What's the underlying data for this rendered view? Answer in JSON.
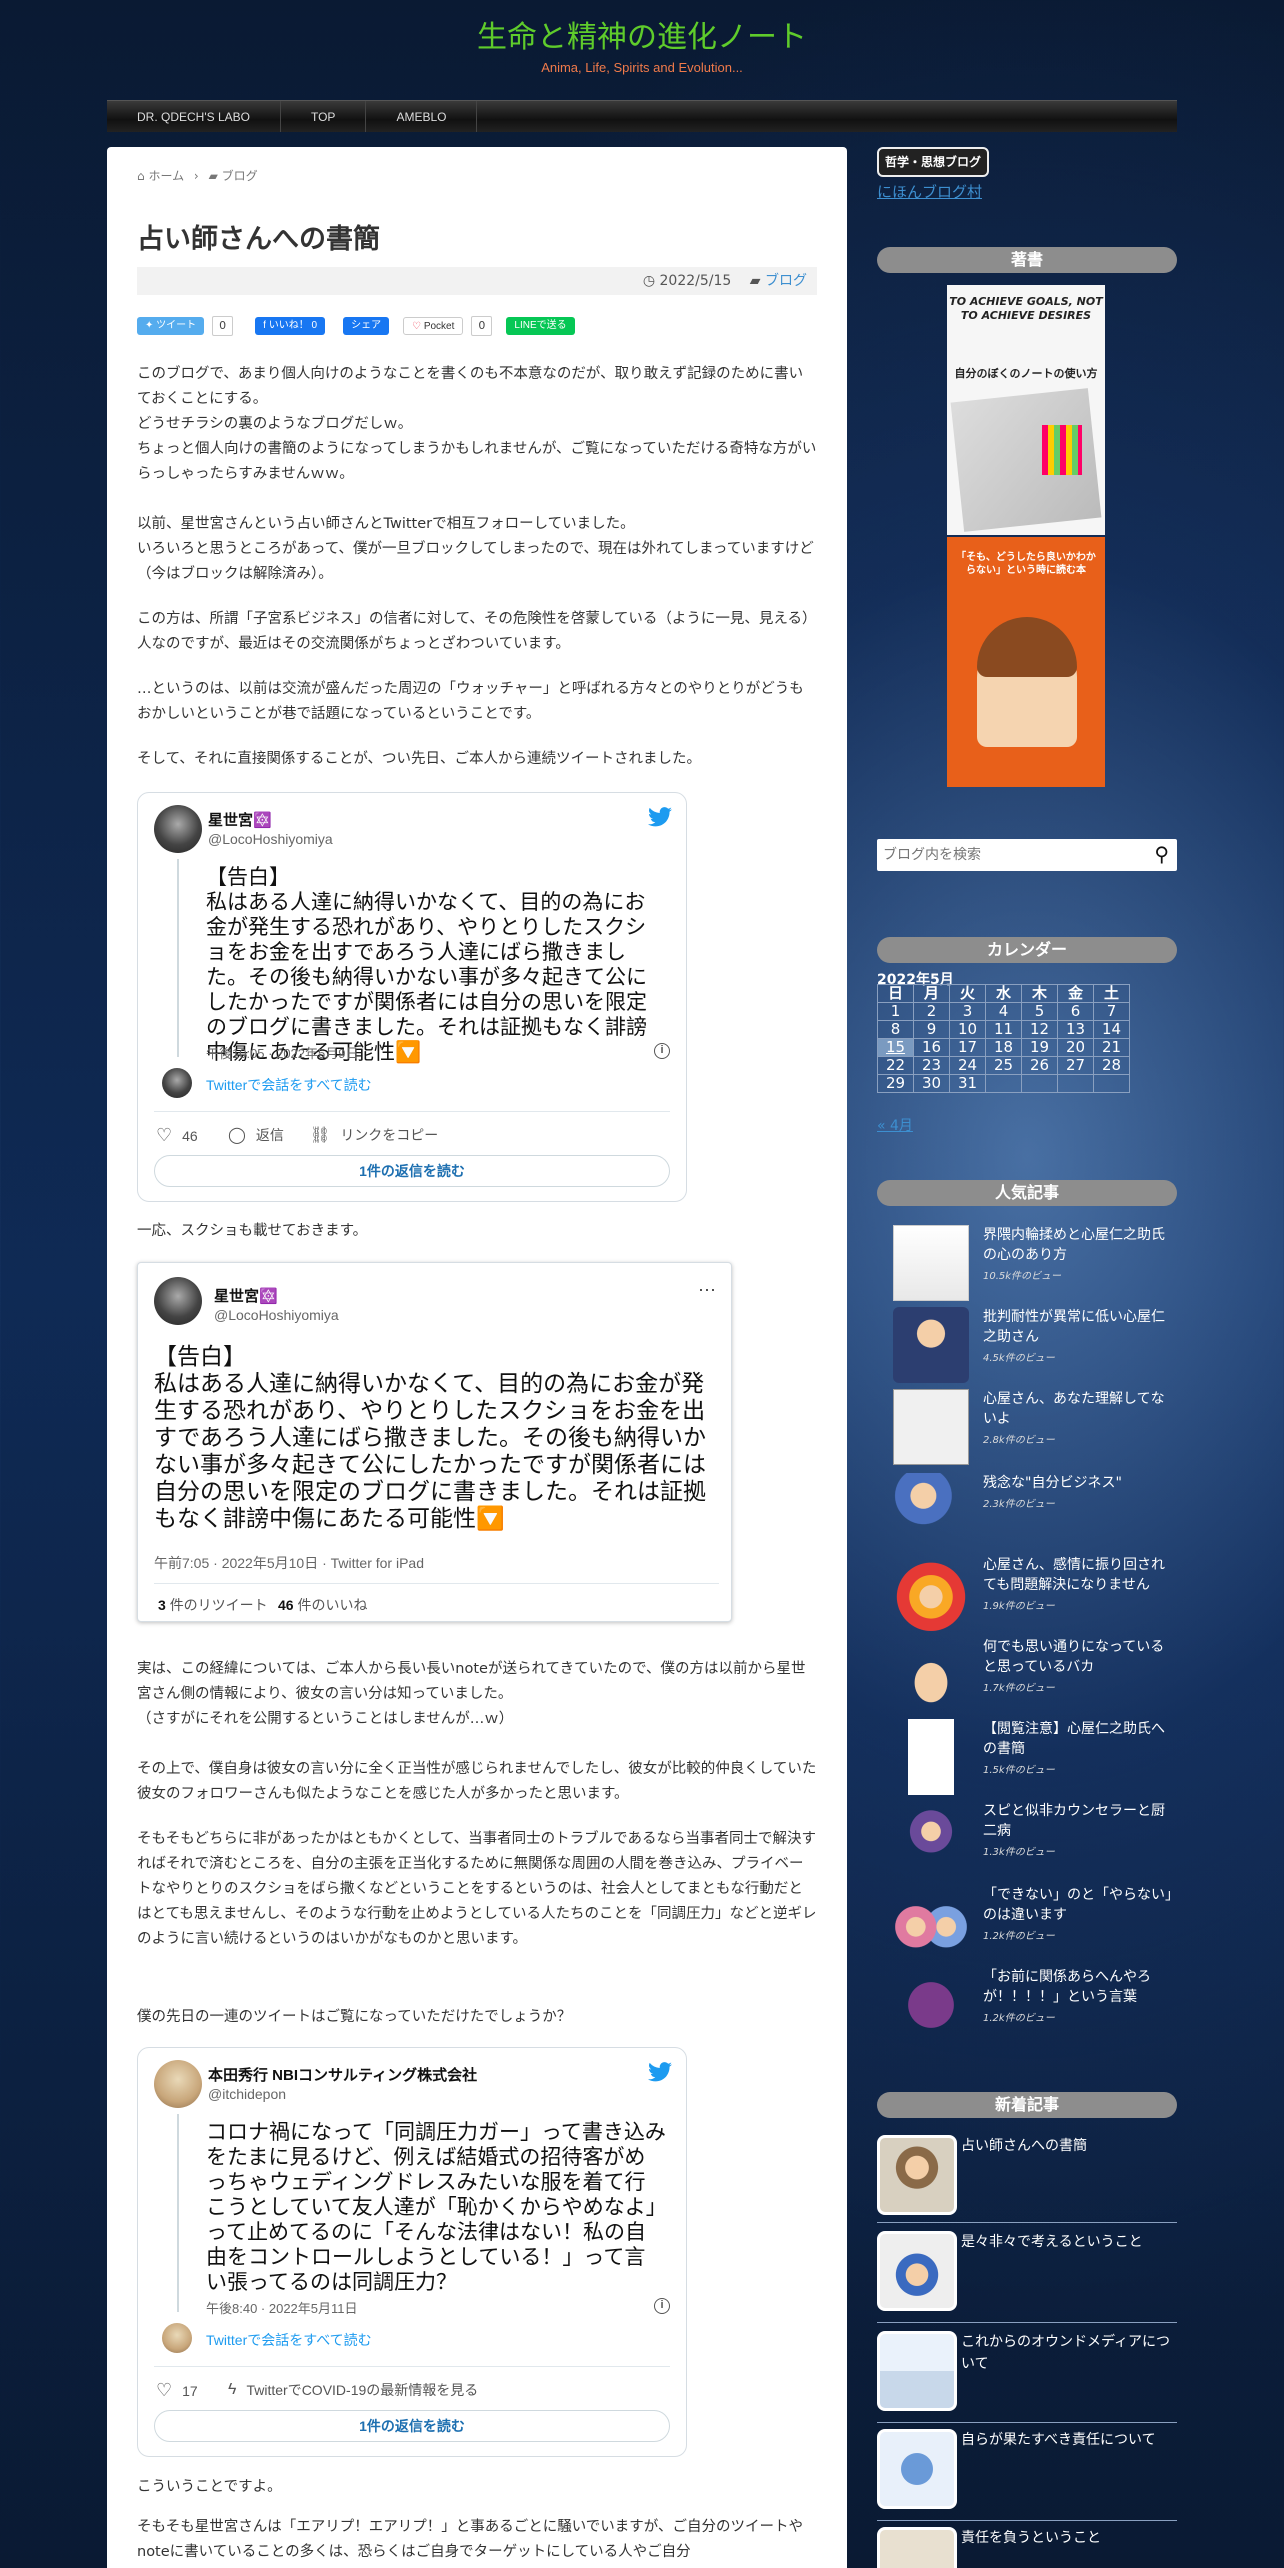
{
  "header": {
    "title": "生命と精神の進化ノート",
    "tagline": "Anima, Life, Spirits and Evolution..."
  },
  "nav": [
    "DR. QDECH'S LABO",
    "TOP",
    "AMEBLO"
  ],
  "breadcrumb": {
    "home": "ホーム",
    "separator": "›",
    "category": "ブログ"
  },
  "post": {
    "title": "占い師さんへの書簡",
    "date": "2022/5/15",
    "category": "ブログ",
    "share": {
      "tweet": "ツイート",
      "tweet_count": "0",
      "like": "いいね！",
      "like_count": "0",
      "share": "シェア",
      "pocket": "Pocket",
      "pocket_count": "0",
      "line": "LINEで送る"
    },
    "p1": "このブログで、あまり個人向けのようなことを書くのも不本意なのだが、取り敢えず記録のために書いておくことにする。\nどうせチラシの裏のようなブログだしｗ。\nちょっと個人向けの書簡のようになってしまうかもしれませんが、ご覧になっていただける奇特な方がいらっしゃったらすみませんｗｗ。",
    "p2": "以前、星世宮さんという占い師さんとTwitterで相互フォローしていました。\nいろいろと思うところがあって、僕が一旦ブロックしてしまったので、現在は外れてしまっていますけど（今はブロックは解除済み）。",
    "p3": "この方は、所謂「子宮系ビジネス」の信者に対して、その危険性を啓蒙している（ように一見、見える）人なのですが、最近はその交流関係がちょっとざわついています。",
    "p4": "…というのは、以前は交流が盛んだった周辺の「ウォッチャー」と呼ばれる方々とのやりとりがどうもおかしいということが巷で話題になっているということです。",
    "p5": "そして、それに直接関係することが、つい先日、ご本人から連続ツイートされました。",
    "p6": "一応、スクショも載せておきます。",
    "p7": "実は、この経緯については、ご本人から長い長いnoteが送られてきていたので、僕の方は以前から星世宮さん側の情報により、彼女の言い分は知っていました。\n（さすがにそれを公開するということはしませんが…ｗ）",
    "p8": "その上で、僕自身は彼女の言い分に全く正当性が感じられませんでしたし、彼女が比較的仲良くしていた彼女のフォロワーさんも似たようなことを感じた人が多かったと思います。",
    "p9": "そもそもどちらに非があったかはともかくとして、当事者同士のトラブルであるなら当事者同士で解決すればそれで済むところを、自分の主張を正当化するために無関係な周囲の人間を巻き込み、プライベートなやりとりのスクショをばら撒くなどということをするというのは、社会人としてまともな行動だとはとても思えませんし、そのような行動を止めようとしている人たちのことを「同調圧力」などと逆ギレのように言い続けるというのはいかがなものかと思います。",
    "p10": "僕の先日の一連のツイートはご覧になっていただけたでしょうか？",
    "p11": "こういうことですよ。",
    "p12": "そもそも星世宮さんは「エアリプ！エアリプ！」と事あるごとに騒いでいますが、ご自分のツイートやnoteに書いていることの多くは、恐らくはご自身でターゲットにしている人やご自分"
  },
  "tweet1": {
    "name": "星世宮🔯",
    "handle": "@LocoHoshiyomiya",
    "body": "【告白】\n私はある人達に納得いかなくて、目的の為にお金が発生する恐れがあり、やりとりしたスクショをお金を出すであろう人達にばら撒きました。その後も納得いかない事が多々起きて公にしたかったですが関係者には自分の思いを限定のブログに書きました。それは証拠もなく誹謗中傷にあたる可能性🔽",
    "date": "午後10:05 · 2022年5月9日",
    "thread_link": "Twitterで会話をすべて読む",
    "likes": "46",
    "reply": "返信",
    "copy_link": "リンクをコピー",
    "read_replies": "1件の返信を読む"
  },
  "tweet2": {
    "name": "星世宮🔯",
    "handle": "@LocoHoshiyomiya",
    "body": "【告白】\n私はある人達に納得いかなくて、目的の為にお金が発生する恐れがあり、やりとりしたスクショをお金を出すであろう人達にばら撒きました。その後も納得いかない事が多々起きて公にしたかったですが関係者には自分の思いを限定のブログに書きました。それは証拠もなく誹謗中傷にあたる可能性🔽",
    "date": "午前7:05 · 2022年5月10日 · Twitter for iPad",
    "retweets": "3",
    "retweets_label": "件のリツイート",
    "likes": "46",
    "likes_label": "件のいいね"
  },
  "tweet3": {
    "name": "本田秀行 NBIコンサルティング株式会社",
    "handle": "@itchidepon",
    "body": "コロナ禍になって「同調圧力ガー」って書き込みをたまに見るけど、例えば結婚式の招待客がめっちゃウェディングドレスみたいな服を着て行こうとしていて友人達が「恥かくからやめなよ」って止めてるのに「そんな法律はない！私の自由をコントロールしようとしている！」って言い張ってるのは同調圧力？",
    "date": "午後8:40 · 2022年5月11日",
    "thread_link": "Twitterで会話をすべて読む",
    "likes": "17",
    "covid": "TwitterでCOVID-19の最新情報を見る",
    "read_replies": "1件の返信を読む"
  },
  "sidebar": {
    "ranking_badge": "哲学・思想ブログ",
    "ranking_link": "にほんブログ村",
    "books_head": "著書",
    "book1_title": "TO ACHIEVE GOALS, NOT TO ACHIEVE DESIRES",
    "book1_sub": "自分のぼくのノートの使い方",
    "book2_title": "「そも、どうしたら良いかわからない」という時に読む本",
    "search_placeholder": "ブログ内を検索",
    "calendar_head": "カレンダー",
    "calendar": {
      "caption": "2022年5月",
      "days": [
        "日",
        "月",
        "火",
        "水",
        "木",
        "金",
        "土"
      ],
      "weeks": [
        [
          "1",
          "2",
          "3",
          "4",
          "5",
          "6",
          "7"
        ],
        [
          "8",
          "9",
          "10",
          "11",
          "12",
          "13",
          "14"
        ],
        [
          "15",
          "16",
          "17",
          "18",
          "19",
          "20",
          "21"
        ],
        [
          "22",
          "23",
          "24",
          "25",
          "26",
          "27",
          "28"
        ],
        [
          "29",
          "30",
          "31",
          "",
          "",
          "",
          ""
        ]
      ],
      "today": "15",
      "prev": "« 4月"
    },
    "popular_head": "人気記事",
    "popular": [
      {
        "title": "界隈内輪揉めと心屋仁之助氏の心のあり方",
        "views": "10.5k件のビュー"
      },
      {
        "title": "批判耐性が異常に低い心屋仁之助さん",
        "views": "4.5k件のビュー"
      },
      {
        "title": "心屋さん、あなた理解してないよ",
        "views": "2.8k件のビュー"
      },
      {
        "title": "残念な\"自分ビジネス\"",
        "views": "2.3k件のビュー"
      },
      {
        "title": "心屋さん、感情に振り回されても問題解決になりません",
        "views": "1.9k件のビュー"
      },
      {
        "title": "何でも思い通りになっていると思っているバカ",
        "views": "1.7k件のビュー"
      },
      {
        "title": "【閲覧注意】心屋仁之助氏への書簡",
        "views": "1.5k件のビュー"
      },
      {
        "title": "スピと似非カウンセラーと厨二病",
        "views": "1.3k件のビュー"
      },
      {
        "title": "「できない」のと「やらない」のは違います",
        "views": "1.2k件のビュー"
      },
      {
        "title": "「お前に関係あらへんやろが！！！！」という言葉",
        "views": "1.2k件のビュー"
      }
    ],
    "new_head": "新着記事",
    "new": [
      {
        "title": "占い師さんへの書簡"
      },
      {
        "title": "是々非々で考えるということ"
      },
      {
        "title": "これからのオウンドメディアについて"
      },
      {
        "title": "自らが果たすべき責任について"
      },
      {
        "title": "責任を負うということ"
      }
    ]
  },
  "colors": {
    "title_green": "#5fcc2b",
    "tagline_orange": "#f07a4a",
    "link_blue": "#3d8fd0",
    "twitter_blue": "#1d9bf0",
    "sidebar_head_gray": "#8d8d8d"
  }
}
